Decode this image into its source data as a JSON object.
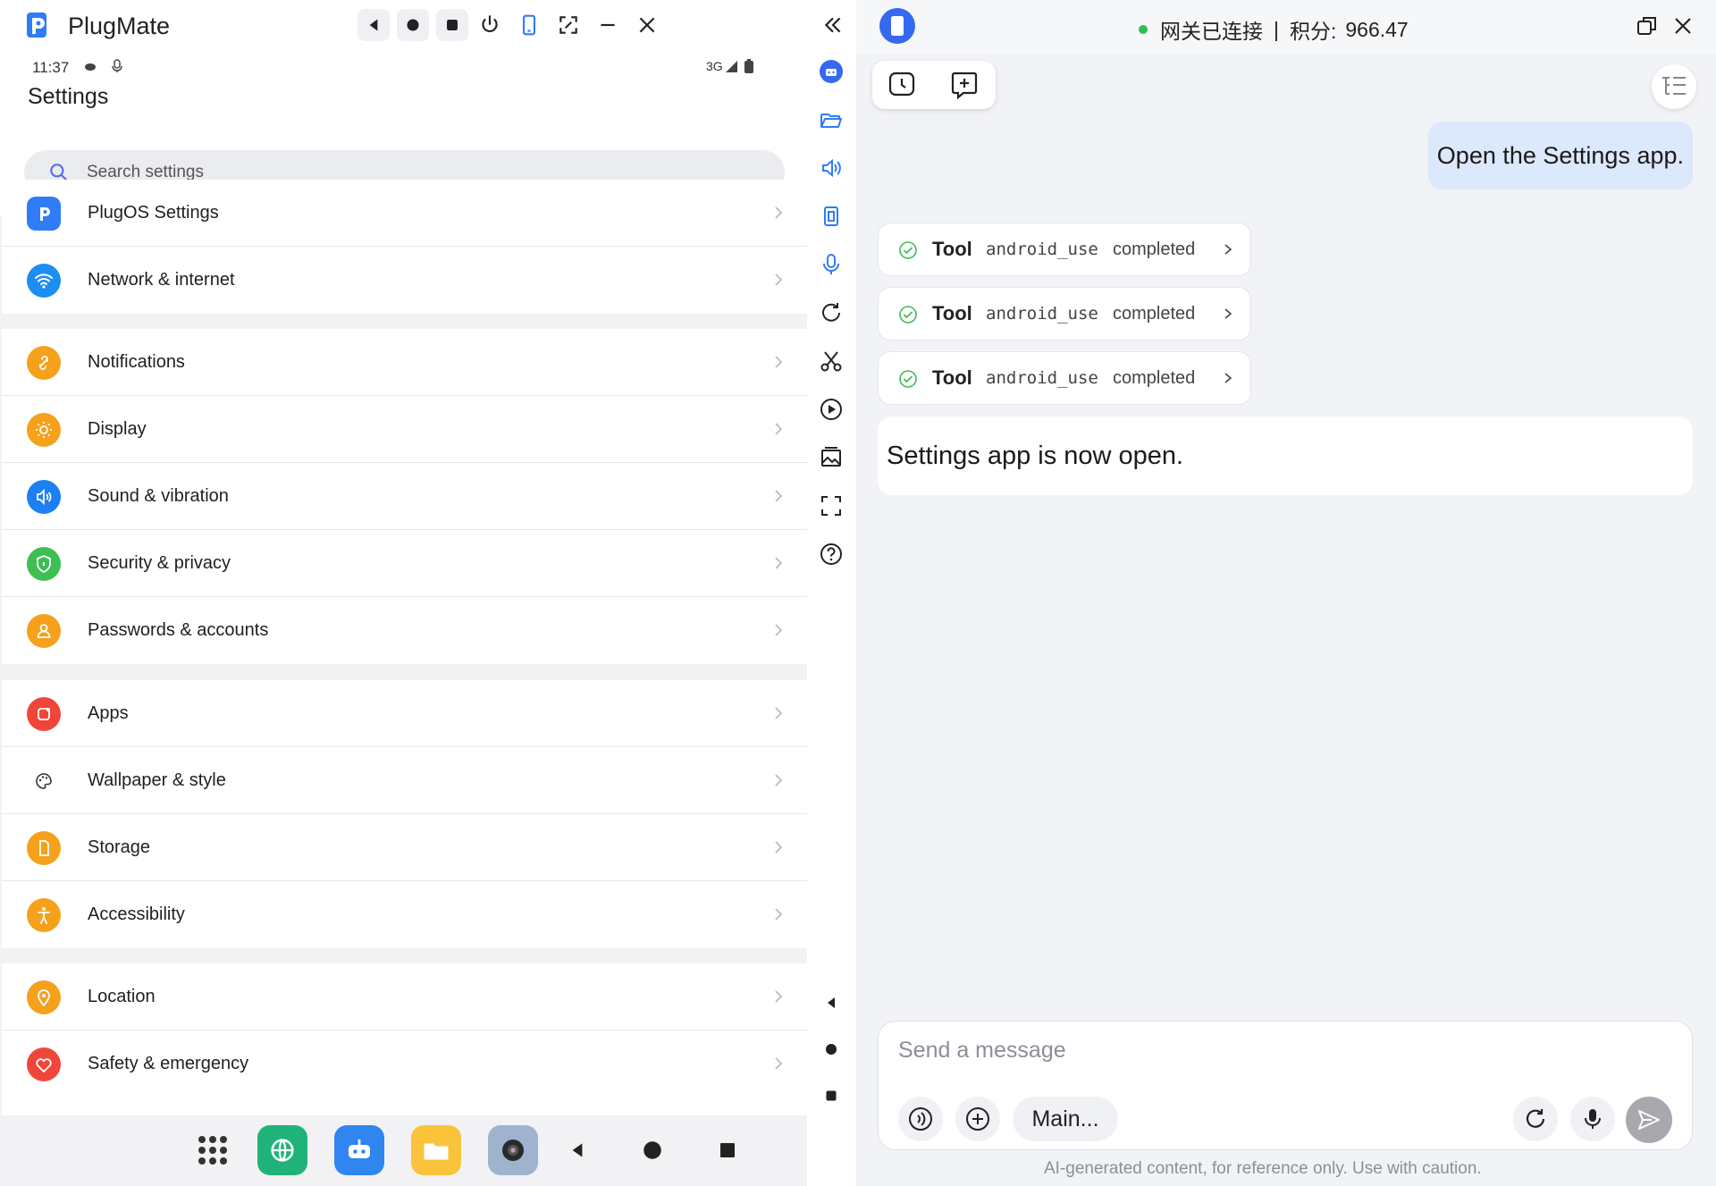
{
  "window": {
    "app_title": "PlugMate"
  },
  "phone": {
    "status_time": "11:37",
    "status_network": "3G",
    "settings_title": "Settings",
    "search_placeholder": "Search settings",
    "groups": [
      [
        {
          "label": "PlugOS Settings",
          "icon": "plugos-logo-icon",
          "color": "#2f7cf6"
        },
        {
          "label": "Network & internet",
          "icon": "wifi-icon",
          "color": "#1c8df2"
        }
      ],
      [
        {
          "label": "Notifications",
          "icon": "bell-icon",
          "color": "#f5a11c"
        },
        {
          "label": "Display",
          "icon": "sun-icon",
          "color": "#f5a11c"
        },
        {
          "label": "Sound & vibration",
          "icon": "speaker-icon",
          "color": "#1c7ff2"
        },
        {
          "label": "Security & privacy",
          "icon": "shield-icon",
          "color": "#3dbf52"
        },
        {
          "label": "Passwords & accounts",
          "icon": "person-icon",
          "color": "#f5a11c"
        }
      ],
      [
        {
          "label": "Apps",
          "icon": "apps-icon",
          "color": "#f0463a"
        },
        {
          "label": "Wallpaper & style",
          "icon": "palette-icon",
          "color": "#ffffff"
        },
        {
          "label": "Storage",
          "icon": "storage-icon",
          "color": "#f5a11c"
        },
        {
          "label": "Accessibility",
          "icon": "accessibility-icon",
          "color": "#f5a11c"
        }
      ],
      [
        {
          "label": "Location",
          "icon": "location-pin-icon",
          "color": "#f5a11c"
        },
        {
          "label": "Safety & emergency",
          "icon": "heart-icon",
          "color": "#f0463a"
        }
      ]
    ]
  },
  "chat": {
    "gateway_status": "网关已连接",
    "points_label": "积分:",
    "points_value": "966.47",
    "user_message": "Open the Settings app.",
    "tool_calls": [
      {
        "word": "Tool",
        "name": "android_use",
        "status": "completed"
      },
      {
        "word": "Tool",
        "name": "android_use",
        "status": "completed"
      },
      {
        "word": "Tool",
        "name": "android_use",
        "status": "completed"
      }
    ],
    "assistant_message": "Settings app is now open.",
    "composer_placeholder": "Send a message",
    "model_label": "Main...",
    "disclaimer": "AI-generated content, for reference only. Use with caution."
  },
  "colors": {
    "accent": "#3569f0",
    "connected": "#2fbf54",
    "user_bubble": "#dce8fb"
  }
}
